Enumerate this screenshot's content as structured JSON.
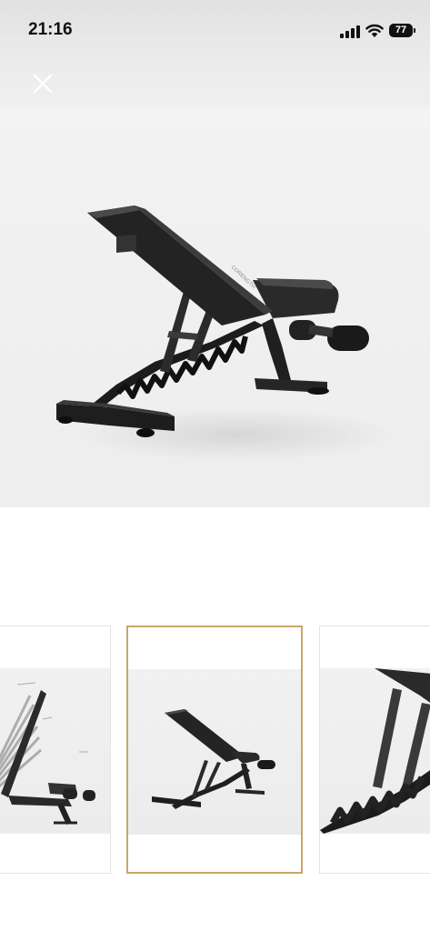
{
  "status_bar": {
    "time": "21:16",
    "battery": "77"
  },
  "close_button": {
    "icon": "close-icon"
  },
  "gallery": {
    "main_image": {
      "brand_text": "CORENGTH"
    },
    "thumbnails": [
      {
        "image": "bench-adjustment-angles",
        "selected": false
      },
      {
        "image": "bench-incline-side-view",
        "selected": true
      },
      {
        "image": "bench-ladder-closeup",
        "selected": false
      }
    ]
  },
  "colors": {
    "selected_border": "#c9a66b",
    "bench_dark": "#1e1e1e"
  }
}
